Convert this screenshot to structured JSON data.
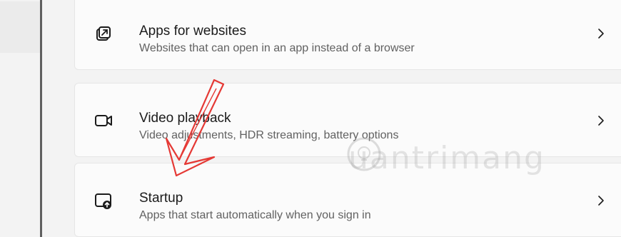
{
  "settings_list": {
    "items": [
      {
        "title": "Apps for websites",
        "subtitle": "Websites that can open in an app instead of a browser",
        "icon": "open-external-square-icon"
      },
      {
        "title": "Video playback",
        "subtitle": "Video adjustments, HDR streaming, battery options",
        "icon": "video-camera-icon"
      },
      {
        "title": "Startup",
        "subtitle": "Apps that start automatically when you sign in",
        "icon": "startup-icon"
      }
    ]
  },
  "watermark": {
    "text": "uantrimang"
  },
  "colors": {
    "background": "#f3f3f3",
    "card": "#fbfbfb",
    "arrow": "#e53935"
  }
}
